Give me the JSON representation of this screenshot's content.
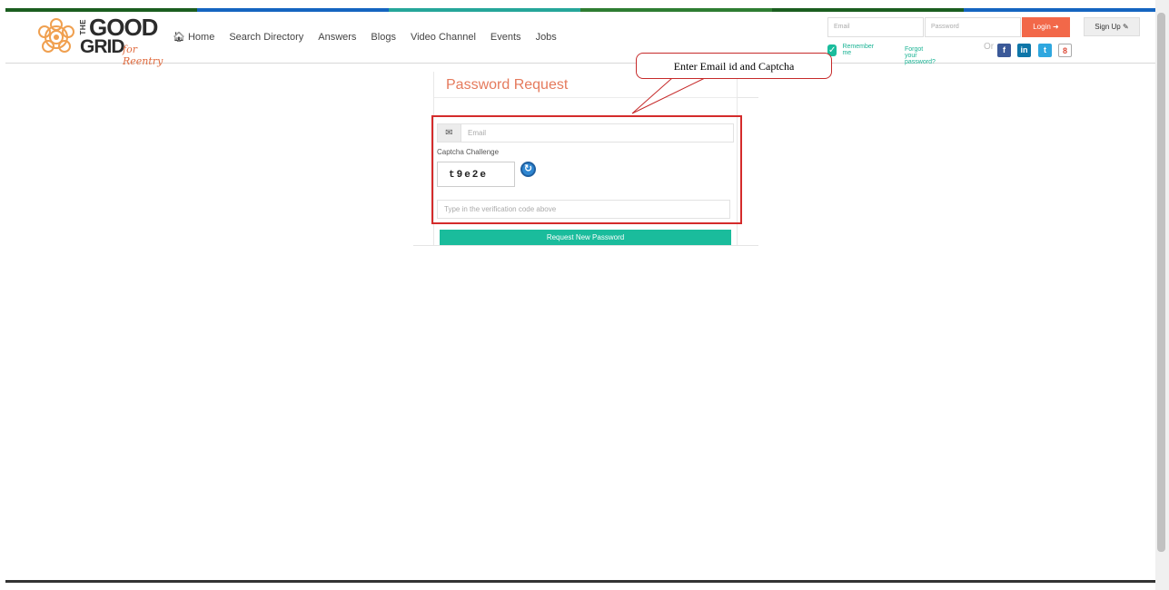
{
  "brand": {
    "the": "THE",
    "good": "GOOD",
    "grid": "GRID",
    "tagline": "for Reentry",
    "colors": [
      "#1b5e20",
      "#1565c0",
      "#26a69a",
      "#2e7d32",
      "#1b5e20",
      "#1565c0"
    ]
  },
  "nav": {
    "home_icon": "home-icon",
    "items": [
      "Home",
      "Search Directory",
      "Answers",
      "Blogs",
      "Video Channel",
      "Events",
      "Jobs"
    ]
  },
  "login": {
    "email_placeholder": "Email",
    "password_placeholder": "Password",
    "login_label": "Login",
    "login_icon": "login-arrow-icon",
    "signup_label": "Sign Up",
    "signup_icon": "edit-icon",
    "remember_label": "Remember me",
    "forgot_label": "Forgot your password?",
    "or_label": "Or",
    "social": [
      {
        "name": "facebook",
        "glyph": "f",
        "color": "#3b5998"
      },
      {
        "name": "linkedin",
        "glyph": "in",
        "color": "#0e76a8"
      },
      {
        "name": "twitter",
        "glyph": "t",
        "color": "#2fa7df"
      },
      {
        "name": "google",
        "glyph": "8",
        "color": "#dd4b39"
      }
    ]
  },
  "panel": {
    "title": "Password Request",
    "email_placeholder": "Email",
    "captcha_label": "Captcha Challenge",
    "captcha_code": "t9e2e",
    "verify_placeholder": "Type in the verification code above",
    "submit_label": "Request New Password"
  },
  "annotation": {
    "callout_text": "Enter Email id and Captcha",
    "color": "#d42b2b"
  }
}
